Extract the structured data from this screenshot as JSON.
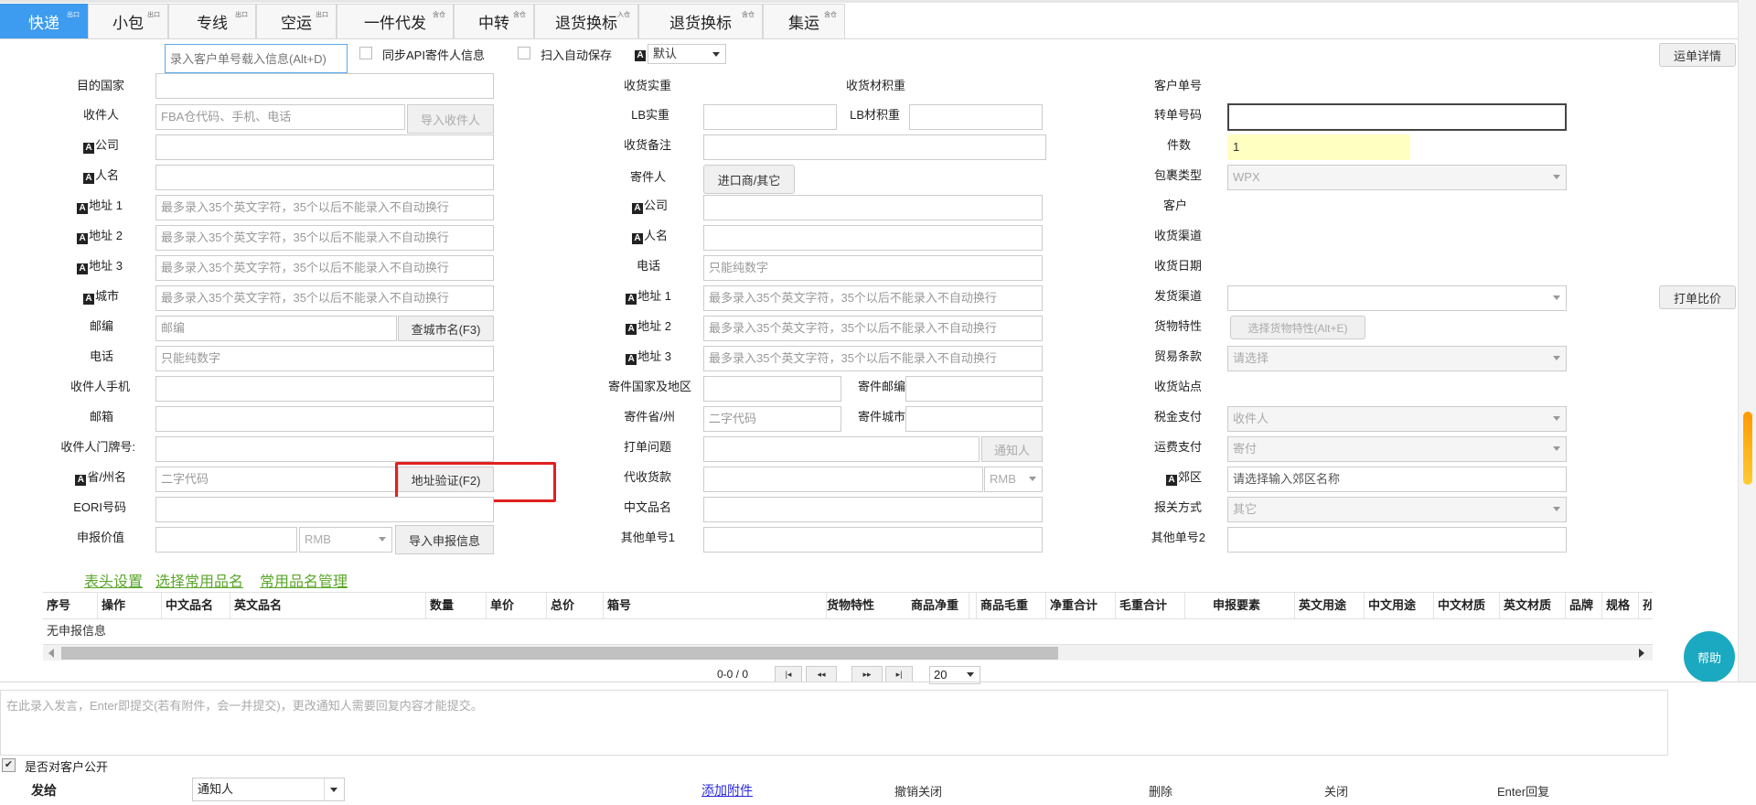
{
  "tabs": [
    {
      "label": "快递",
      "tag": "出口"
    },
    {
      "label": "小包",
      "tag": "出口"
    },
    {
      "label": "专线",
      "tag": "出口"
    },
    {
      "label": "空运",
      "tag": "出口"
    },
    {
      "label": "一件代发",
      "tag": "含仓"
    },
    {
      "label": "中转",
      "tag": "含仓"
    },
    {
      "label": "退货换标",
      "tag": "入仓"
    },
    {
      "label": "退货换标",
      "tag": "含仓"
    },
    {
      "label": "集运",
      "tag": "含仓"
    }
  ],
  "toolbar": {
    "order_input_placeholder": "录入客户单号载入信息(Alt+D)",
    "sync_api_label": "同步API寄件人信息",
    "auto_save_label": "扫入自动保存",
    "font_select_value": "默认",
    "waybill_detail_button": "运单详情",
    "print_compare_button": "打单比价"
  },
  "recipient": {
    "country_label": "目的国家",
    "name_label": "收件人",
    "name_placeholder": "FBA仓代码、手机、电话",
    "import_button": "导入收件人",
    "company_label": "公司",
    "person_label": "人名",
    "addr1_label": "地址 1",
    "addr2_label": "地址 2",
    "addr3_label": "地址 3",
    "city_label": "城市",
    "addr_placeholder": "最多录入35个英文字符，35个以后不能录入不自动换行",
    "zip_label": "邮编",
    "zip_placeholder": "邮编",
    "city_lookup_button": "查城市名(F3)",
    "phone_label": "电话",
    "phone_placeholder": "只能纯数字",
    "mobile_label": "收件人手机",
    "email_label": "邮箱",
    "doorplate_label": "收件人门牌号:",
    "state_label": "省/州名",
    "state_placeholder": "二字代码",
    "verify_button": "地址验证(F2)",
    "eori_label": "EORI号码",
    "declared_label": "申报价值",
    "declared_currency": "RMB",
    "import_declare_button": "导入申报信息"
  },
  "middle": {
    "actual_weight_label": "收货实重",
    "volume_weight_label": "收货材积重",
    "lb_actual_label": "LB实重",
    "lb_volume_label": "LB材积重",
    "remark_label": "收货备注",
    "sender_label": "寄件人",
    "importer_button": "进口商/其它",
    "company_label": "公司",
    "person_label": "人名",
    "phone_label": "电话",
    "phone_placeholder": "只能纯数字",
    "addr1_label": "地址 1",
    "addr2_label": "地址 2",
    "addr3_label": "地址 3",
    "addr_placeholder": "最多录入35个英文字符，35个以后不能录入不自动换行",
    "sender_country_label": "寄件国家及地区",
    "sender_zip_label": "寄件邮编",
    "sender_state_label": "寄件省/州",
    "sender_state_placeholder": "二字代码",
    "sender_city_label": "寄件城市",
    "print_issue_label": "打单问题",
    "notify_button": "通知人",
    "cod_label": "代收货款",
    "cod_currency": "RMB",
    "cn_name_label": "中文品名",
    "other_no1_label": "其他单号1"
  },
  "right": {
    "customer_no_label": "客户单号",
    "transfer_no_label": "转单号码",
    "pieces_label": "件数",
    "pieces_value": "1",
    "package_type_label": "包裹类型",
    "package_type_value": "WPX",
    "customer_label": "客户",
    "channel_label": "收货渠道",
    "date_label": "收货日期",
    "ship_channel_label": "发货渠道",
    "goods_label": "货物特性",
    "goods_button": "选择货物特性(Alt+E)",
    "trade_label": "贸易条款",
    "trade_value": "请选择",
    "station_label": "收货站点",
    "tax_label": "税金支付",
    "tax_value": "收件人",
    "freight_label": "运费支付",
    "freight_value": "寄付",
    "suburb_label": "郊区",
    "suburb_placeholder": "请选择输入郊区名称",
    "customs_label": "报关方式",
    "customs_value": "其它",
    "other_no2_label": "其他单号2"
  },
  "links": {
    "header_settings": "表头设置",
    "choose_items": "选择常用品名",
    "manage_items": "常用品名管理"
  },
  "table": {
    "columns": [
      "序号",
      "操作",
      "中文品名",
      "英文品名",
      "数量",
      "单价",
      "总价",
      "箱号",
      "货物特性",
      "商品净重",
      "商品毛重",
      "净重合计",
      "毛重合计",
      "申报要素",
      "英文用途",
      "中文用途",
      "中文材质",
      "英文材质",
      "品牌",
      "规格",
      "孙"
    ],
    "empty_text": "无申报信息",
    "pager_text": "0-0 / 0",
    "page_size": "20"
  },
  "help_button": "帮助",
  "message": {
    "placeholder": "在此录入发言，Enter即提交(若有附件，会一并提交)，更改通知人需要回复内容才能提交。",
    "public_label": "是否对客户公开",
    "send_to_label": "发给",
    "recipient_value": "通知人",
    "attach_link": "添加附件",
    "cancel_close": "撤销关闭",
    "delete": "删除",
    "close": "关闭",
    "enter_reply": "Enter回复"
  },
  "colors": {
    "accent": "#3d9bf0",
    "link_green": "#5aa629",
    "help_teal": "#1aa9c0",
    "highlight_yellow": "#ffffc2",
    "red_box": "#e02020"
  }
}
